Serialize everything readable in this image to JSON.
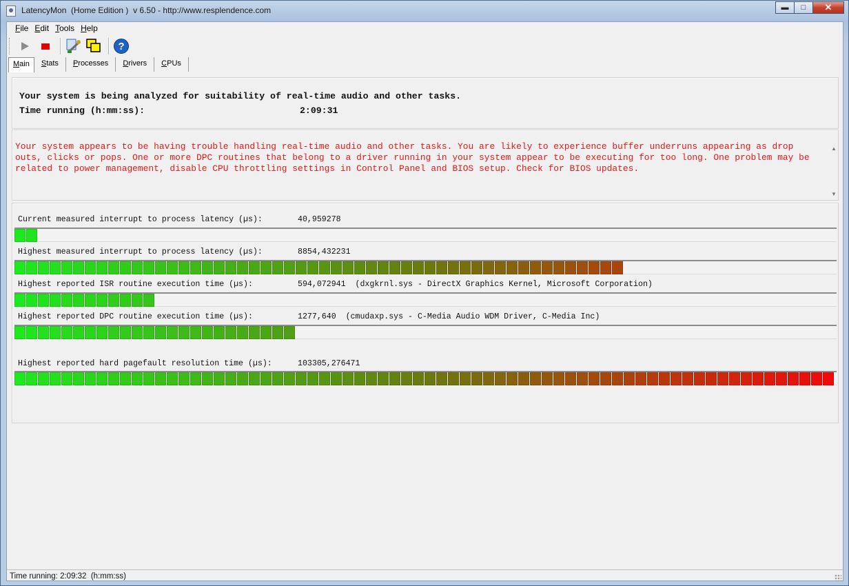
{
  "window": {
    "title": "LatencyMon  (Home Edition )  v 6.50 - http://www.resplendence.com",
    "buttons": {
      "minimize": "▬",
      "maximize": "□",
      "close": "✕"
    }
  },
  "menu": [
    {
      "key": "F",
      "rest": "ile"
    },
    {
      "key": "E",
      "rest": "dit"
    },
    {
      "key": "T",
      "rest": "ools"
    },
    {
      "key": "H",
      "rest": "elp"
    }
  ],
  "toolbar": {
    "icons": [
      "play-icon",
      "stop-icon",
      "wrench-icon",
      "windows-icon",
      "help-icon"
    ],
    "colors": {
      "stop": "#e00000",
      "play": "#8c8c8c",
      "help": "#1f62c4"
    }
  },
  "tabs": [
    {
      "key": "M",
      "rest": "ain",
      "active": true
    },
    {
      "key": "S",
      "rest": "tats"
    },
    {
      "key": "P",
      "rest": "rocesses"
    },
    {
      "key": "D",
      "rest": "rivers"
    },
    {
      "key": "C",
      "rest": "PUs"
    }
  ],
  "summary": {
    "line1": "Your system is being analyzed for suitability of real-time audio and other tasks.",
    "time_label": "Time running (h:mm:ss):",
    "time_value": "2:09:31"
  },
  "warning": {
    "text": "Your system appears to be having trouble handling real-time audio and other tasks. You are likely to experience buffer underruns appearing as drop outs, clicks or pops. One or more DPC routines that belong to a driver running in your system appear to be executing for too long. One problem may be related to power management, disable CPU throttling settings in Control Panel and BIOS setup. Check for BIOS updates.",
    "color": "#e81818"
  },
  "metrics": [
    {
      "label": "Current measured interrupt to process latency (µs):",
      "value": "40,959278",
      "detail": "",
      "level": 0.03
    },
    {
      "label": "Highest measured interrupt to process latency (µs):",
      "value": "8854,432231",
      "detail": "",
      "level": 0.74
    },
    {
      "label": "Highest reported ISR routine execution time (µs):",
      "value": "594,072941",
      "detail": "(dxgkrnl.sys - DirectX Graphics Kernel, Microsoft Corporation)",
      "level": 0.17
    },
    {
      "label": "Highest reported DPC routine execution time (µs):",
      "value": "1277,640",
      "detail": "(cmudaxp.sys - C-Media Audio WDM Driver, C-Media Inc)",
      "level": 0.34
    },
    {
      "label": "Highest reported hard pagefault resolution time (µs):",
      "value": "103305,276471",
      "detail": "",
      "level": 1.0
    }
  ],
  "bar_colors": {
    "low": "#1ee81e",
    "mid": "#6a7a10",
    "high": "#f00a0a"
  },
  "status": {
    "text": "Time running: 2:09:32  (h:mm:ss)"
  }
}
